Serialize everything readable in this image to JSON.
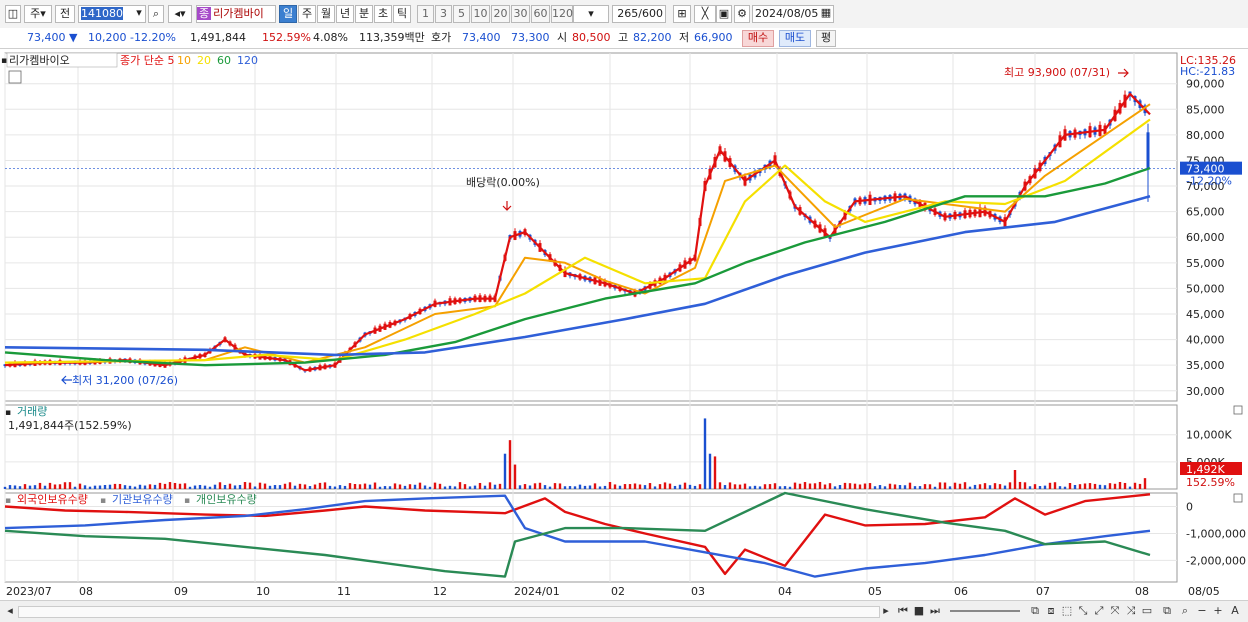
{
  "toolbar": {
    "code": "141080",
    "market_label": "주",
    "prev_label": "전",
    "stock_name": "리가켐바이",
    "stock_name_badge": "종",
    "period_tabs": [
      "일",
      "주",
      "월",
      "년",
      "분",
      "초",
      "틱"
    ],
    "active_period": "일",
    "minute_tabs": [
      "1",
      "3",
      "5",
      "10",
      "20",
      "30",
      "60",
      "120"
    ],
    "count_value": "265",
    "count_total": "/600",
    "date_value": "2024/08/05"
  },
  "info": {
    "price": "73,400",
    "change": "10,200",
    "change_pct": "-12.20%",
    "volume": "1,491,844",
    "volume_ratio": "152.59%",
    "turnover_rate": "4.08%",
    "amount": "113,359백만",
    "quote_label": "호가",
    "ask": "73,400",
    "bid": "73,300",
    "open_label": "시",
    "open": "80,500",
    "high_label": "고",
    "high": "82,200",
    "low_label": "저",
    "low": "66,900",
    "buy_label": "매수",
    "sell_label": "매도",
    "eval_label": "평"
  },
  "panels": {
    "price_title": "리가켐바이오",
    "price_legend": [
      {
        "label": "종가 단순 5",
        "color": "#e01010"
      },
      {
        "label": "10",
        "color": "#f5a000"
      },
      {
        "label": "20",
        "color": "#f5e000"
      },
      {
        "label": "60",
        "color": "#1a9a3a"
      },
      {
        "label": "120",
        "color": "#2f5fd8"
      }
    ],
    "lc_label": "LC:135.26",
    "hc_label": "HC:-21.83",
    "high_annotation": "최고 93,900 (07/31)",
    "low_annotation": "최저 31,200 (07/26)",
    "dividend_annotation": "배당락(0.00%)",
    "current_price_tag": "73,400",
    "current_pct_tag": "-12.20%",
    "volume_title": "거래량",
    "volume_summary": "1,491,844주(152.59%)",
    "volume_tag": "1,492K",
    "volume_pct_tag": "152.59%",
    "holders_legend": [
      {
        "label": "외국인보유수량",
        "color": "#e01010"
      },
      {
        "label": "기관보유수량",
        "color": "#2f5fd8"
      },
      {
        "label": "개인보유수량",
        "color": "#2a8a55"
      }
    ]
  },
  "axes": {
    "price_ticks": [
      "90,000",
      "85,000",
      "80,000",
      "75,000",
      "70,000",
      "65,000",
      "60,000",
      "55,000",
      "50,000",
      "45,000",
      "40,000",
      "35,000",
      "30,000"
    ],
    "volume_ticks": [
      "10,000K",
      "5,000K"
    ],
    "holder_ticks": [
      "0",
      "-1,000,000",
      "-2,000,000"
    ],
    "month_labels": [
      "2023/07",
      "08",
      "09",
      "10",
      "11",
      "12",
      "2024/01",
      "02",
      "03",
      "04",
      "05",
      "06",
      "07",
      "08"
    ],
    "last_date_label": "08/05"
  },
  "chart_data": {
    "type": "candlestick",
    "title": "리가켐바이오",
    "series": [
      {
        "name": "종가 단순 5",
        "points": [
          [
            0,
            35000
          ],
          [
            40,
            35500
          ],
          [
            80,
            35500
          ],
          [
            120,
            36000
          ],
          [
            160,
            35000
          ],
          [
            200,
            37000
          ],
          [
            220,
            40000
          ],
          [
            240,
            37000
          ],
          [
            280,
            36000
          ],
          [
            300,
            34000
          ],
          [
            330,
            35000
          ],
          [
            360,
            41000
          ],
          [
            400,
            44000
          ],
          [
            430,
            47000
          ],
          [
            470,
            48000
          ],
          [
            490,
            48000
          ],
          [
            505,
            60000
          ],
          [
            520,
            61000
          ],
          [
            560,
            53000
          ],
          [
            600,
            51000
          ],
          [
            630,
            49000
          ],
          [
            660,
            52000
          ],
          [
            690,
            56000
          ],
          [
            700,
            70000
          ],
          [
            715,
            77000
          ],
          [
            740,
            71000
          ],
          [
            770,
            75000
          ],
          [
            790,
            66000
          ],
          [
            825,
            60000
          ],
          [
            850,
            67000
          ],
          [
            900,
            68000
          ],
          [
            940,
            64000
          ],
          [
            980,
            65000
          ],
          [
            1000,
            63000
          ],
          [
            1020,
            70000
          ],
          [
            1060,
            80000
          ],
          [
            1100,
            81000
          ],
          [
            1125,
            88000
          ],
          [
            1145,
            84000
          ]
        ]
      },
      {
        "name": "10",
        "points": [
          [
            0,
            35500
          ],
          [
            200,
            36000
          ],
          [
            240,
            38500
          ],
          [
            300,
            35500
          ],
          [
            360,
            38500
          ],
          [
            430,
            45000
          ],
          [
            490,
            46500
          ],
          [
            520,
            56000
          ],
          [
            560,
            55000
          ],
          [
            600,
            51500
          ],
          [
            640,
            49000
          ],
          [
            690,
            54000
          ],
          [
            720,
            71000
          ],
          [
            770,
            74000
          ],
          [
            800,
            68000
          ],
          [
            830,
            62000
          ],
          [
            900,
            67500
          ],
          [
            960,
            66000
          ],
          [
            1000,
            65000
          ],
          [
            1040,
            72000
          ],
          [
            1100,
            80000
          ],
          [
            1145,
            86000
          ]
        ]
      },
      {
        "name": "20",
        "points": [
          [
            0,
            35500
          ],
          [
            200,
            36000
          ],
          [
            260,
            37000
          ],
          [
            330,
            36000
          ],
          [
            400,
            40000
          ],
          [
            470,
            45000
          ],
          [
            520,
            49000
          ],
          [
            580,
            56000
          ],
          [
            640,
            51000
          ],
          [
            700,
            52000
          ],
          [
            740,
            67000
          ],
          [
            780,
            74000
          ],
          [
            820,
            67000
          ],
          [
            860,
            63000
          ],
          [
            940,
            67000
          ],
          [
            1000,
            66500
          ],
          [
            1060,
            71000
          ],
          [
            1145,
            83000
          ]
        ]
      },
      {
        "name": "60",
        "points": [
          [
            0,
            37500
          ],
          [
            100,
            36000
          ],
          [
            200,
            35000
          ],
          [
            300,
            35500
          ],
          [
            380,
            37000
          ],
          [
            450,
            39500
          ],
          [
            520,
            44000
          ],
          [
            600,
            48000
          ],
          [
            690,
            51000
          ],
          [
            740,
            55000
          ],
          [
            800,
            59000
          ],
          [
            880,
            63000
          ],
          [
            960,
            68000
          ],
          [
            1040,
            68000
          ],
          [
            1100,
            70500
          ],
          [
            1145,
            73500
          ]
        ]
      },
      {
        "name": "120",
        "points": [
          [
            0,
            38500
          ],
          [
            200,
            38000
          ],
          [
            330,
            37000
          ],
          [
            420,
            37500
          ],
          [
            520,
            40500
          ],
          [
            620,
            44000
          ],
          [
            700,
            47000
          ],
          [
            780,
            52500
          ],
          [
            860,
            57000
          ],
          [
            960,
            61000
          ],
          [
            1050,
            63000
          ],
          [
            1145,
            68000
          ]
        ]
      }
    ],
    "ylim": [
      28000,
      96000
    ],
    "volume_ylim": [
      0,
      14000
    ],
    "holders_ylim": [
      -2800000,
      500000
    ],
    "volume_bars": [
      {
        "x": 500,
        "v": 6500
      },
      {
        "x": 505,
        "v": 9000
      },
      {
        "x": 510,
        "v": 4500
      },
      {
        "x": 700,
        "v": 13000
      },
      {
        "x": 705,
        "v": 6500
      },
      {
        "x": 710,
        "v": 6000
      },
      {
        "x": 1010,
        "v": 3500
      },
      {
        "x": 1140,
        "v": 2000
      }
    ],
    "holders": [
      {
        "name": "외국인보유수량",
        "points": [
          [
            0,
            0
          ],
          [
            60,
            -150000
          ],
          [
            120,
            -200000
          ],
          [
            200,
            -300000
          ],
          [
            260,
            -350000
          ],
          [
            320,
            -150000
          ],
          [
            360,
            0
          ],
          [
            420,
            -150000
          ],
          [
            500,
            -250000
          ],
          [
            540,
            300000
          ],
          [
            560,
            -200000
          ],
          [
            600,
            -650000
          ],
          [
            640,
            -1000000
          ],
          [
            700,
            -1500000
          ],
          [
            720,
            -2500000
          ],
          [
            740,
            -1600000
          ],
          [
            780,
            -2200000
          ],
          [
            820,
            -300000
          ],
          [
            860,
            -700000
          ],
          [
            920,
            -650000
          ],
          [
            980,
            -400000
          ],
          [
            1010,
            300000
          ],
          [
            1040,
            -300000
          ],
          [
            1080,
            200000
          ],
          [
            1145,
            450000
          ]
        ]
      },
      {
        "name": "기관보유수량",
        "points": [
          [
            0,
            -800000
          ],
          [
            80,
            -700000
          ],
          [
            160,
            -500000
          ],
          [
            240,
            -350000
          ],
          [
            300,
            -100000
          ],
          [
            360,
            200000
          ],
          [
            420,
            300000
          ],
          [
            500,
            400000
          ],
          [
            520,
            -800000
          ],
          [
            560,
            -1300000
          ],
          [
            640,
            -1300000
          ],
          [
            700,
            -1700000
          ],
          [
            760,
            -2100000
          ],
          [
            810,
            -2600000
          ],
          [
            860,
            -2300000
          ],
          [
            920,
            -2100000
          ],
          [
            980,
            -1800000
          ],
          [
            1040,
            -1400000
          ],
          [
            1100,
            -1100000
          ],
          [
            1145,
            -900000
          ]
        ]
      },
      {
        "name": "개인보유수량",
        "points": [
          [
            0,
            -900000
          ],
          [
            80,
            -1100000
          ],
          [
            160,
            -1200000
          ],
          [
            240,
            -1500000
          ],
          [
            320,
            -1800000
          ],
          [
            360,
            -2000000
          ],
          [
            440,
            -2400000
          ],
          [
            500,
            -2600000
          ],
          [
            510,
            -1300000
          ],
          [
            560,
            -800000
          ],
          [
            620,
            -800000
          ],
          [
            700,
            -900000
          ],
          [
            780,
            500000
          ],
          [
            860,
            -100000
          ],
          [
            940,
            -600000
          ],
          [
            1000,
            -900000
          ],
          [
            1040,
            -1400000
          ],
          [
            1100,
            -1300000
          ],
          [
            1145,
            -1800000
          ]
        ]
      }
    ]
  }
}
